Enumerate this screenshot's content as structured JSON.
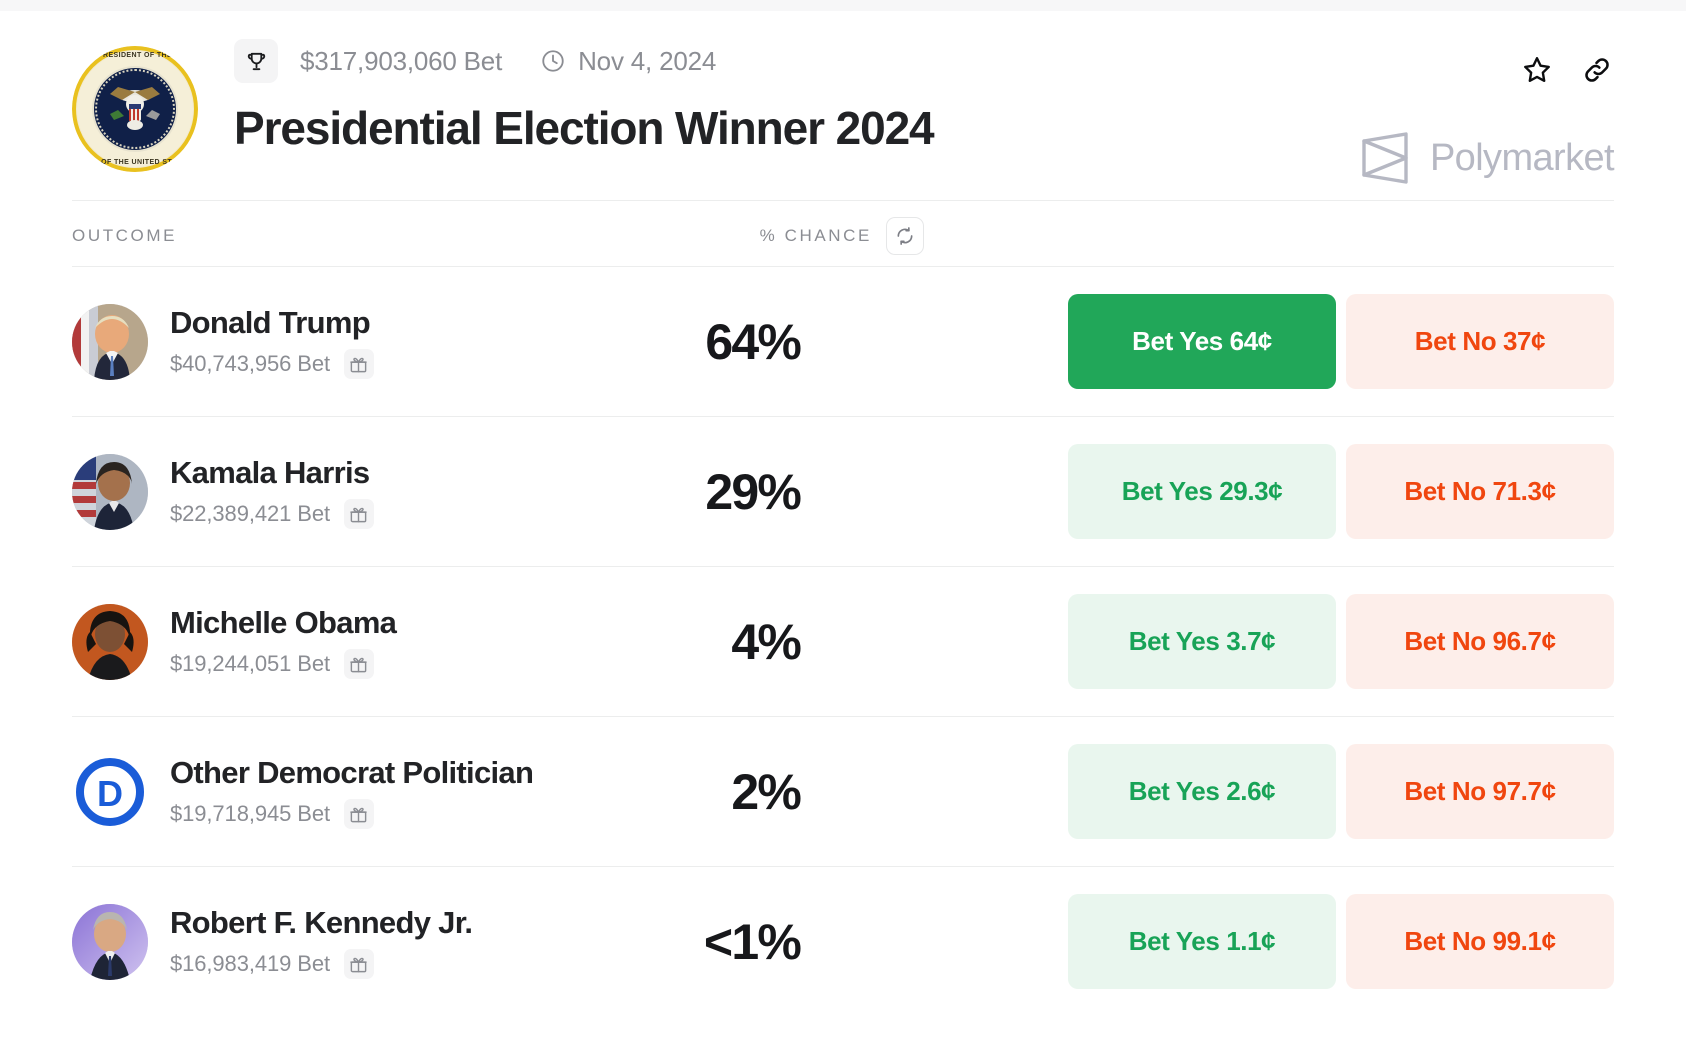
{
  "header": {
    "avatar_icon": "presidential-seal-icon",
    "seal_top_text": "PRESIDENT OF THE",
    "seal_bottom_text": "SEAL OF THE UNITED STATES",
    "trophy_icon": "trophy-icon",
    "volume": "$317,903,060 Bet",
    "clock_icon": "clock-icon",
    "date": "Nov 4, 2024",
    "title": "Presidential Election Winner 2024",
    "star_icon": "star-icon",
    "link_icon": "link-icon",
    "brand_logo_icon": "polymarket-logo-icon",
    "brand_name": "Polymarket"
  },
  "table": {
    "col_outcome": "OUTCOME",
    "col_chance": "% CHANCE",
    "refresh_icon": "refresh-icon",
    "gift_icon": "gift-icon",
    "rows": [
      {
        "name": "Donald Trump",
        "bet": "$40,743,956 Bet",
        "chance": "64%",
        "yes_label": "Bet Yes 64¢",
        "no_label": "Bet No 37¢",
        "yes_style": "solid",
        "avatar_icon": "donald-trump-avatar"
      },
      {
        "name": "Kamala Harris",
        "bet": "$22,389,421 Bet",
        "chance": "29%",
        "yes_label": "Bet Yes 29.3¢",
        "no_label": "Bet No 71.3¢",
        "yes_style": "soft",
        "avatar_icon": "kamala-harris-avatar"
      },
      {
        "name": "Michelle Obama",
        "bet": "$19,244,051 Bet",
        "chance": "4%",
        "yes_label": "Bet Yes 3.7¢",
        "no_label": "Bet No 96.7¢",
        "yes_style": "soft",
        "avatar_icon": "michelle-obama-avatar"
      },
      {
        "name": "Other Democrat Politician",
        "bet": "$19,718,945 Bet",
        "chance": "2%",
        "yes_label": "Bet Yes 2.6¢",
        "no_label": "Bet No 97.7¢",
        "yes_style": "soft",
        "avatar_icon": "democratic-party-logo"
      },
      {
        "name": "Robert F. Kennedy Jr.",
        "bet": "$16,983,419 Bet",
        "chance": "<1%",
        "yes_label": "Bet Yes 1.1¢",
        "no_label": "Bet No 99.1¢",
        "yes_style": "soft",
        "avatar_icon": "robert-f-kennedy-jr-avatar"
      }
    ]
  },
  "colors": {
    "green_solid": "#21a759",
    "green_soft_bg": "#e9f6ee",
    "green_text": "#18a357",
    "red_soft_bg": "#fdeeea",
    "red_text": "#f0460f",
    "muted_text": "#8b8d93",
    "primary_text": "#222326",
    "brand_gray": "#b6b8c3",
    "democrat_blue": "#1a5cd8"
  }
}
